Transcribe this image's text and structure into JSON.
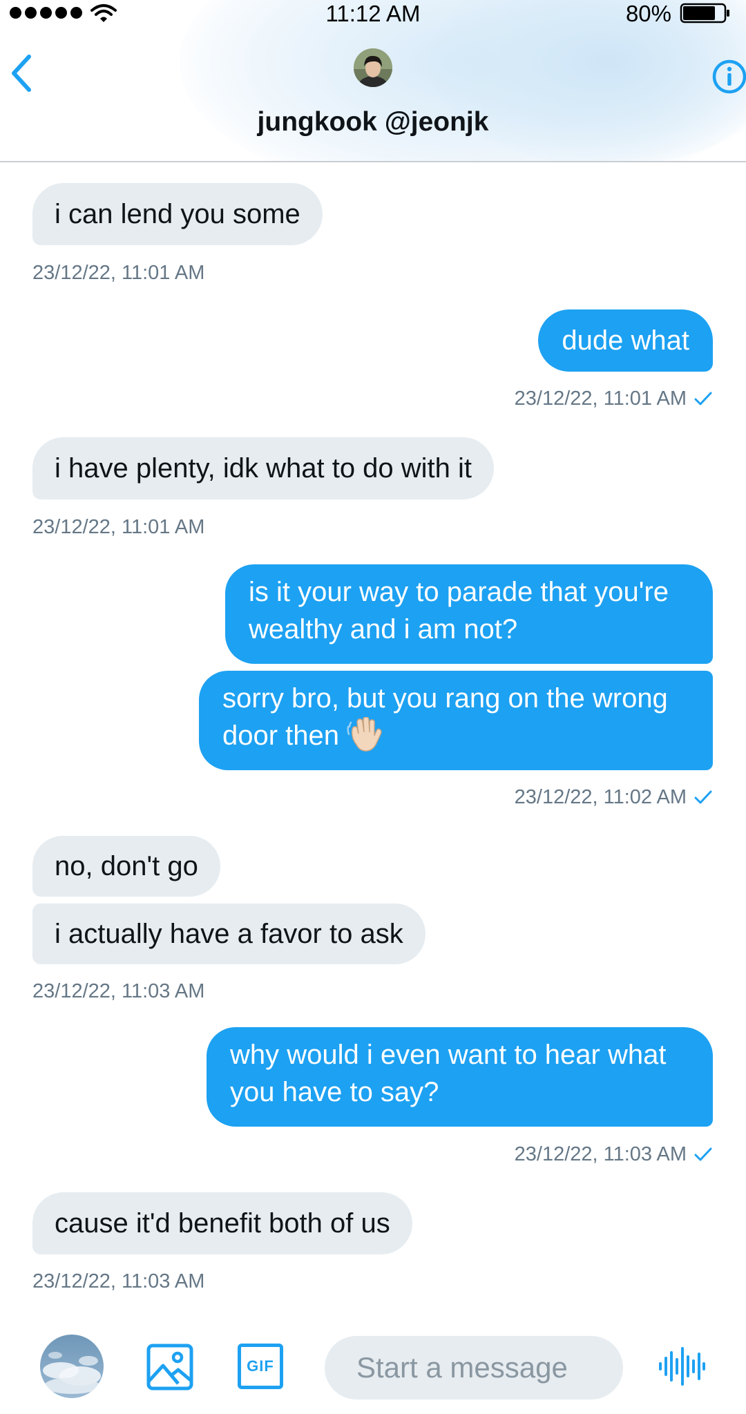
{
  "status_bar": {
    "time": "11:12 AM",
    "battery": "80%",
    "signal_bars": 5
  },
  "conversation": {
    "title": "jungkook @jeonjk",
    "back_icon": "chevron-left-icon",
    "info_icon": "info-circle-icon"
  },
  "messages": [
    {
      "side": "in",
      "text": "i can lend you some"
    },
    {
      "side": "in",
      "timestamp": "23/12/22, 11:01 AM"
    },
    {
      "side": "out",
      "text": "dude what"
    },
    {
      "side": "out",
      "timestamp": "23/12/22, 11:01 AM",
      "read": true
    },
    {
      "side": "in",
      "text": "i have plenty, idk what to do with it"
    },
    {
      "side": "in",
      "timestamp": "23/12/22, 11:01 AM"
    },
    {
      "side": "out",
      "text": "is it your way to parade that you're wealthy and i am not?"
    },
    {
      "side": "out",
      "text": "sorry bro, but you rang on the wrong door then",
      "emoji": "waving-hand"
    },
    {
      "side": "out",
      "timestamp": "23/12/22, 11:02 AM",
      "read": true
    },
    {
      "side": "in",
      "text": "no, don't go"
    },
    {
      "side": "in",
      "text": "i actually have a favor to ask"
    },
    {
      "side": "in",
      "timestamp": "23/12/22, 11:03 AM"
    },
    {
      "side": "out",
      "text": "why would i even want to hear what you have to say?"
    },
    {
      "side": "out",
      "timestamp": "23/12/22, 11:03 AM",
      "read": true
    },
    {
      "side": "in",
      "text": "cause it'd benefit both of us"
    },
    {
      "side": "in",
      "timestamp": "23/12/22, 11:03 AM"
    }
  ],
  "composer": {
    "placeholder": "Start a message",
    "gif_label": "GIF",
    "image_icon": "image-icon",
    "voice_icon": "voice-waveform-icon"
  },
  "colors": {
    "accent": "#1da1f2",
    "incoming_bubble": "#e6ecf0",
    "timestamp": "#657786"
  }
}
